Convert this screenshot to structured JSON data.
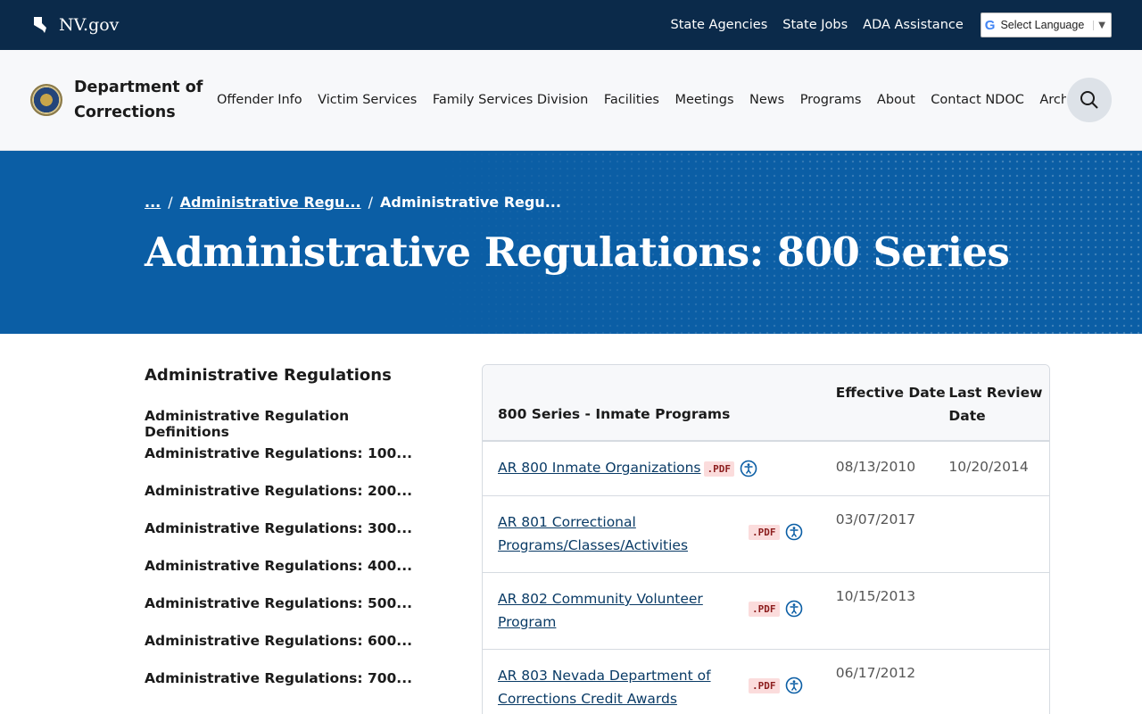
{
  "topbar": {
    "brand": "NV.gov",
    "links": [
      "State Agencies",
      "State Jobs",
      "ADA Assistance"
    ],
    "language": "Select Language"
  },
  "header": {
    "dept": "Department of Corrections",
    "nav": [
      "Offender Info",
      "Victim Services",
      "Family Services Division",
      "Facilities",
      "Meetings",
      "News",
      "Programs",
      "About",
      "Contact NDOC",
      "Archives"
    ]
  },
  "hero": {
    "breadcrumbs": [
      "...",
      "Administrative Regu...",
      "Administrative Regu..."
    ],
    "title": "Administrative Regulations: 800 Series"
  },
  "sidebar": {
    "title": "Administrative Regulations",
    "items": [
      "Administrative Regulation Definitions",
      "Administrative Regulations: 100...",
      "Administrative Regulations: 200...",
      "Administrative Regulations: 300...",
      "Administrative Regulations: 400...",
      "Administrative Regulations: 500...",
      "Administrative Regulations: 600...",
      "Administrative Regulations: 700..."
    ]
  },
  "table": {
    "headers": [
      "800 Series - Inmate Programs",
      "Effective Date",
      "Last Review Date"
    ],
    "pdf_label": ".PDF",
    "rows": [
      {
        "title": "AR 800 Inmate Organizations",
        "effective": "08/13/2010",
        "review": "10/20/2014"
      },
      {
        "title": "AR 801 Correctional Programs/Classes/Activities",
        "effective": "03/07/2017",
        "review": ""
      },
      {
        "title": "AR 802 Community Volunteer Program",
        "effective": "10/15/2013",
        "review": ""
      },
      {
        "title": "AR 803 Nevada Department of Corrections Credit Awards",
        "effective": "06/17/2012",
        "review": ""
      }
    ]
  },
  "colors": {
    "topbar": "#0b2a4a",
    "hero": "#0b5ea5",
    "link": "#0a3b66"
  }
}
